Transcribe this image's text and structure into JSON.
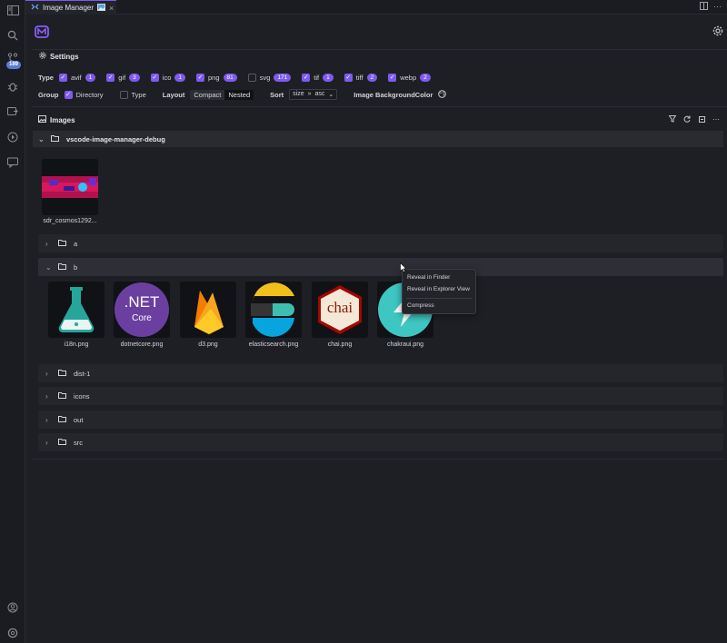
{
  "tab": {
    "title": "Image Manager",
    "close": "×"
  },
  "activity": {
    "badge": "189"
  },
  "settings": {
    "title": "Settings",
    "type_label": "Type",
    "types": [
      {
        "name": "avif",
        "count": "1",
        "checked": true
      },
      {
        "name": "gif",
        "count": "3",
        "checked": true
      },
      {
        "name": "ico",
        "count": "1",
        "checked": true
      },
      {
        "name": "png",
        "count": "81",
        "checked": true
      },
      {
        "name": "svg",
        "count": "171",
        "checked": false
      },
      {
        "name": "tif",
        "count": "1",
        "checked": true
      },
      {
        "name": "tiff",
        "count": "2",
        "checked": true
      },
      {
        "name": "webp",
        "count": "2",
        "checked": true
      }
    ],
    "group_label": "Group",
    "group_directory": "Directory",
    "group_type": "Type",
    "layout_label": "Layout",
    "layout_compact": "Compact",
    "layout_nested": "Nested",
    "sort_label": "Sort",
    "sort_field": "size",
    "sort_field_arrow": "»",
    "sort_order": "asc",
    "bg_color_label": "Image BackgroundColor"
  },
  "images": {
    "title": "Images",
    "root_folder": "vscode-image-manager-debug",
    "root_file": "sdr_cosmos1292...",
    "folders": {
      "a": "a",
      "b": "b",
      "dist": "dist-1",
      "icons": "icons",
      "out": "out",
      "src": "src"
    },
    "b_files": [
      "i18n.png",
      "dotnetcore.png",
      "d3.png",
      "elasticsearch.png",
      "chai.png",
      "chakraui.png"
    ],
    "dotnet_top": ".NET",
    "dotnet_bottom": "Core",
    "chai_text": "chai"
  },
  "context_menu": {
    "reveal_finder": "Reveal in Finder",
    "reveal_explorer": "Reveal in Explorer View",
    "compress": "Compress"
  },
  "colors": {
    "accent": "#7f5af0",
    "background": "#1e1f25"
  }
}
